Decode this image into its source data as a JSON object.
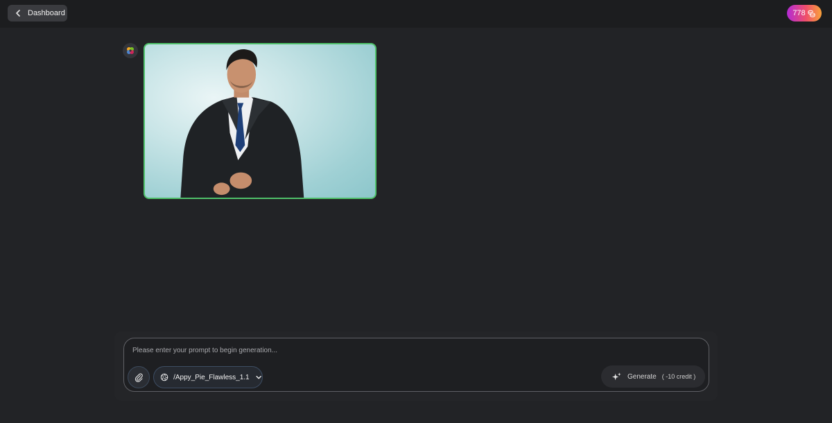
{
  "header": {
    "back_label": "Dashboard",
    "credits": "778"
  },
  "conversation": {
    "avatar_icon": "appy-pie-logo-icon",
    "image_alt": "Man in dark suit with blue tie against light teal background"
  },
  "composer": {
    "placeholder": "Please enter your prompt to begin generation...",
    "value": "",
    "model_label": "/Appy_Pie_Flawless_1.1",
    "generate_label": "Generate",
    "generate_cost": "( -10 credit )"
  },
  "colors": {
    "accent_border": "#4fc26a",
    "credits_gradient": [
      "#b32ad6",
      "#ef4f6a",
      "#f9a23a"
    ]
  }
}
